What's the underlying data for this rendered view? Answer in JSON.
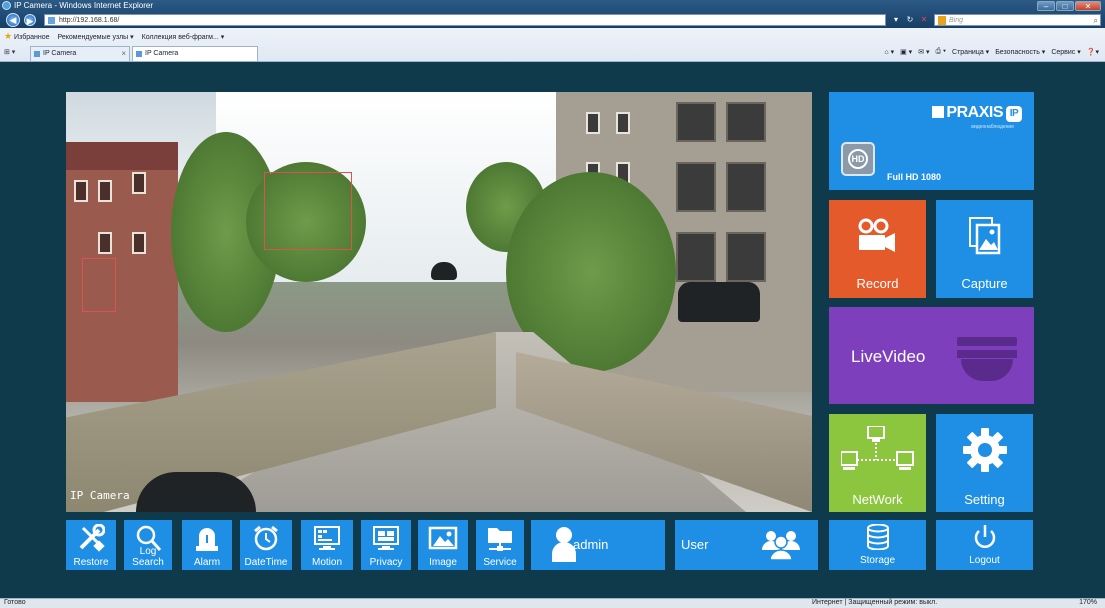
{
  "browser": {
    "window_title": "IP Camera - Windows Internet Explorer",
    "address": "http://192.168.1.68/",
    "search_placeholder": "Bing",
    "favorites_label": "Избранное",
    "favbar_items": [
      "Рекомендуемые узлы ▾",
      "Коллекция веб-фрагм... ▾"
    ],
    "tabs": [
      {
        "label": "IP Camera"
      },
      {
        "label": "IP Camera"
      }
    ],
    "commands": [
      "Страница ▾",
      "Безопасность ▾",
      "Сервис ▾"
    ],
    "status_left": "Готово",
    "status_zone": "Интернет | Защищенный режим: выкл.",
    "zoom": "170%"
  },
  "video": {
    "overlay_label": "IP Camera"
  },
  "brand": {
    "name": "PRAXIS",
    "badge": "IP",
    "tagline": "видеонаблюдение",
    "hd_badge": "HD",
    "resolution_label": "Full HD 1080"
  },
  "tiles": {
    "record": "Record",
    "capture": "Capture",
    "live_video": "LiveVideo",
    "network": "NetWork",
    "setting": "Setting",
    "storage": "Storage",
    "logout": "Logout"
  },
  "toolbar": {
    "restore": "Restore",
    "log_search": "Log Search",
    "alarm": "Alarm",
    "datetime": "DateTime",
    "motion": "Motion",
    "privacy": "Privacy",
    "image": "Image",
    "service": "Service",
    "admin": "admin",
    "user": "User"
  },
  "colors": {
    "background": "#0e3a4c",
    "tile_blue": "#1f8fe6",
    "record_orange": "#e55a2b",
    "live_purple": "#7d3fbc",
    "network_green": "#8cc63f"
  }
}
